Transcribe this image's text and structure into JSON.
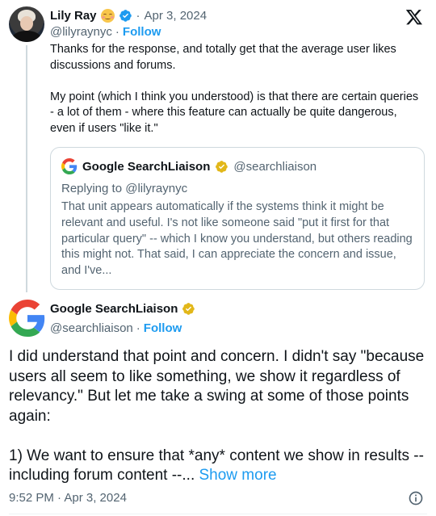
{
  "post1": {
    "author_name": "Lily Ray",
    "date": "Apr 3, 2024",
    "separator": "·",
    "handle": "@lilyraynyc",
    "follow": "Follow",
    "paragraph1": "Thanks for the response, and totally get that the average user likes discussions and forums.",
    "paragraph2": "My point (which I think you understood) is that there are certain queries - a lot of them - where this feature can actually be quite dangerous, even if users \"like it.\"",
    "quote": {
      "author_name": "Google SearchLiaison",
      "handle": "@searchliaison",
      "replying_to": "Replying to @lilyraynyc",
      "text": "That unit appears automatically if the systems think it might be relevant and useful. I's not like someone said \"put it first for that particular query\" -- which I know you understand, but others reading this might not. That said, I can appreciate the concern and issue, and I've..."
    }
  },
  "post2": {
    "author_name": "Google SearchLiaison",
    "handle": "@searchliaison",
    "separator": "·",
    "follow": "Follow",
    "paragraph1": "I did understand that point and concern. I didn't say \"because users all seem to like something, we show it regardless of relevancy.\" But let me take a swing at some of those points again:",
    "paragraph2": "1) We want to ensure that *any* content we show in results -- including forum content --...",
    "show_more": "Show more",
    "timestamp": "9:52 PM · Apr 3, 2024"
  },
  "colors": {
    "link": "#1d9bf0",
    "verified_blue": "#1d9bf0",
    "verified_gold": "#e2b719",
    "secondary_text": "#536471"
  },
  "icons": {
    "x_logo": "x-logo-icon",
    "verified": "verified-badge-icon",
    "gold_check": "gold-checkmark-icon",
    "info": "info-icon",
    "google": "google-g-logo"
  }
}
